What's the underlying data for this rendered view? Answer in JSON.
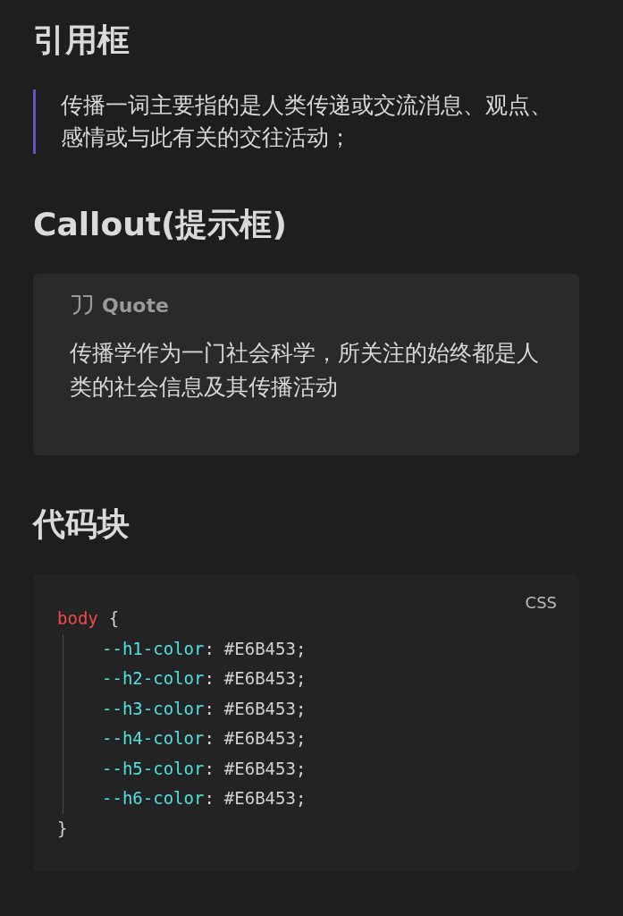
{
  "sections": [
    {
      "heading": "引用框",
      "kind": "blockquote",
      "text": "传播一词主要指的是人类传递或交流消息、观点、感情或与此有关的交往活动；"
    },
    {
      "heading": "Callout(提示框)",
      "kind": "callout",
      "title": "Quote",
      "text": "传播学作为一门社会科学，所关注的始终都是人类的社会信息及其传播活动"
    },
    {
      "heading": "代码块",
      "kind": "code",
      "language": "CSS",
      "lines": [
        {
          "indented": false,
          "tokens": [
            {
              "kind": "selector",
              "text": "body"
            },
            {
              "kind": "brace",
              "text": "{"
            }
          ]
        },
        {
          "indented": true,
          "tokens": [
            {
              "kind": "property",
              "text": "--h1-color"
            },
            {
              "kind": "punct",
              "text": ":"
            },
            {
              "kind": "value",
              "text": "#E6B453;"
            }
          ]
        },
        {
          "indented": true,
          "tokens": [
            {
              "kind": "property",
              "text": "--h2-color"
            },
            {
              "kind": "punct",
              "text": ":"
            },
            {
              "kind": "value",
              "text": "#E6B453;"
            }
          ]
        },
        {
          "indented": true,
          "tokens": [
            {
              "kind": "property",
              "text": "--h3-color"
            },
            {
              "kind": "punct",
              "text": ":"
            },
            {
              "kind": "value",
              "text": "#E6B453;"
            }
          ]
        },
        {
          "indented": true,
          "tokens": [
            {
              "kind": "property",
              "text": "--h4-color"
            },
            {
              "kind": "punct",
              "text": ":"
            },
            {
              "kind": "value",
              "text": "#E6B453;"
            }
          ]
        },
        {
          "indented": true,
          "tokens": [
            {
              "kind": "property",
              "text": "--h5-color"
            },
            {
              "kind": "punct",
              "text": ":"
            },
            {
              "kind": "value",
              "text": "#E6B453;"
            }
          ]
        },
        {
          "indented": true,
          "tokens": [
            {
              "kind": "property",
              "text": "--h6-color"
            },
            {
              "kind": "punct",
              "text": ":"
            },
            {
              "kind": "value",
              "text": "#E6B453;"
            }
          ]
        },
        {
          "indented": false,
          "tokens": [
            {
              "kind": "brace",
              "text": "}"
            }
          ]
        }
      ]
    }
  ]
}
